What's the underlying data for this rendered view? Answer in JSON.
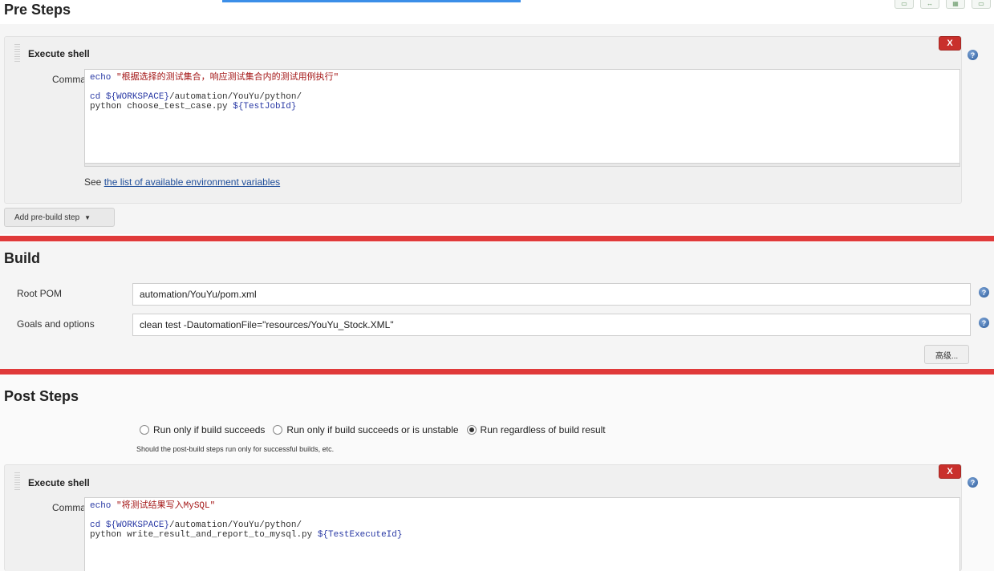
{
  "toolbar": {
    "icons": [
      "window-icon",
      "expand-icon",
      "grid-icon",
      "panel-icon"
    ]
  },
  "pre_steps": {
    "title": "Pre Steps",
    "step": {
      "title": "Execute shell",
      "delete_label": "X",
      "command_label": "Command",
      "command_lines": [
        {
          "parts": [
            {
              "t": "echo ",
              "c": "kw"
            },
            {
              "t": "\"根据选择的测试集合，响应测试集合内的测试用例执行\"",
              "c": "str"
            }
          ]
        },
        {
          "parts": [
            {
              "t": "",
              "c": ""
            }
          ]
        },
        {
          "parts": [
            {
              "t": "cd ",
              "c": "kw"
            },
            {
              "t": "${WORKSPACE}",
              "c": "var"
            },
            {
              "t": "/automation/YouYu/python/",
              "c": ""
            }
          ]
        },
        {
          "parts": [
            {
              "t": "python choose_test_case.py ",
              "c": ""
            },
            {
              "t": "${TestJobId}",
              "c": "var"
            }
          ]
        }
      ],
      "see_prefix": "See ",
      "see_link": "the list of available environment variables"
    },
    "add_button": "Add pre-build step"
  },
  "build": {
    "title": "Build",
    "root_pom_label": "Root POM",
    "root_pom_value": "automation/YouYu/pom.xml",
    "goals_label": "Goals and options",
    "goals_value": "clean test -DautomationFile=\"resources/YouYu_Stock.XML\"",
    "advanced_button": "高级..."
  },
  "post_steps": {
    "title": "Post Steps",
    "radio_options": [
      {
        "label": "Run only if build succeeds",
        "selected": false
      },
      {
        "label": "Run only if build succeeds or is unstable",
        "selected": false
      },
      {
        "label": "Run regardless of build result",
        "selected": true
      }
    ],
    "hint": "Should the post-build steps run only for successful builds, etc.",
    "step": {
      "title": "Execute shell",
      "delete_label": "X",
      "command_label": "Command",
      "command_lines": [
        {
          "parts": [
            {
              "t": "echo ",
              "c": "kw"
            },
            {
              "t": "\"将测试结果写入MySQL\"",
              "c": "str"
            }
          ]
        },
        {
          "parts": [
            {
              "t": "",
              "c": ""
            }
          ]
        },
        {
          "parts": [
            {
              "t": "cd ",
              "c": "kw"
            },
            {
              "t": "${WORKSPACE}",
              "c": "var"
            },
            {
              "t": "/automation/YouYu/python/",
              "c": ""
            }
          ]
        },
        {
          "parts": [
            {
              "t": "python write_result_and_report_to_mysql.py ",
              "c": ""
            },
            {
              "t": "${TestExecuteId}",
              "c": "var"
            }
          ]
        }
      ]
    }
  }
}
